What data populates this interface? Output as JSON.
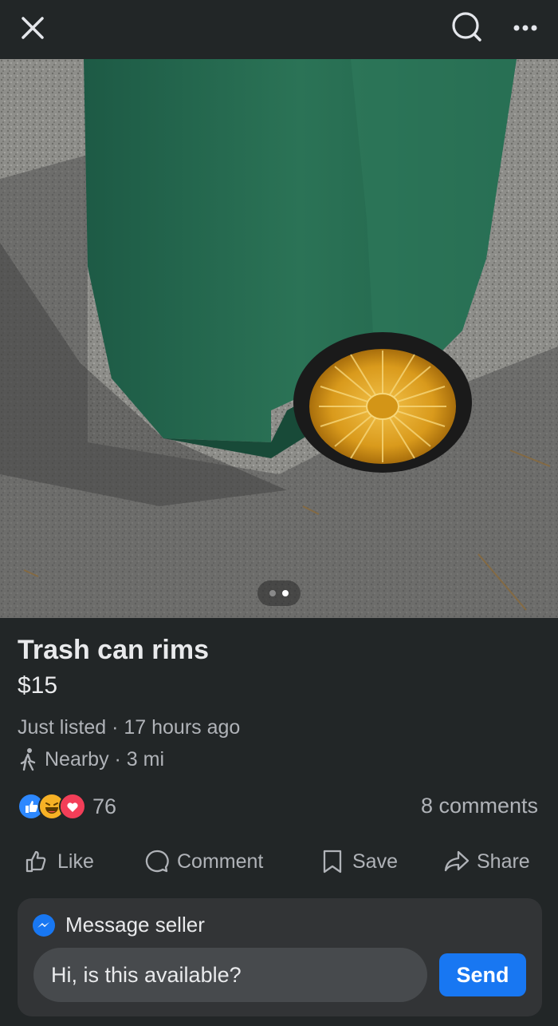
{
  "topbar": {
    "close_icon": "close-icon",
    "search_icon": "search-icon",
    "more_icon": "more-options-icon"
  },
  "gallery": {
    "image_count": 2,
    "current_index": 2
  },
  "listing": {
    "title": "Trash can rims",
    "price": "$15",
    "listed": "Just listed · 17 hours ago",
    "location": "Nearby · 3 mi"
  },
  "engagement": {
    "reactions": [
      "like",
      "haha",
      "love"
    ],
    "reaction_count": "76",
    "comments": "8 comments"
  },
  "actions": {
    "like": "Like",
    "comment": "Comment",
    "save": "Save",
    "share": "Share"
  },
  "message": {
    "header": "Message seller",
    "input_value": "Hi, is this available?",
    "send": "Send"
  },
  "colors": {
    "background": "#222627",
    "accent": "#1877f2",
    "secondary_text": "#b0b3b8"
  }
}
